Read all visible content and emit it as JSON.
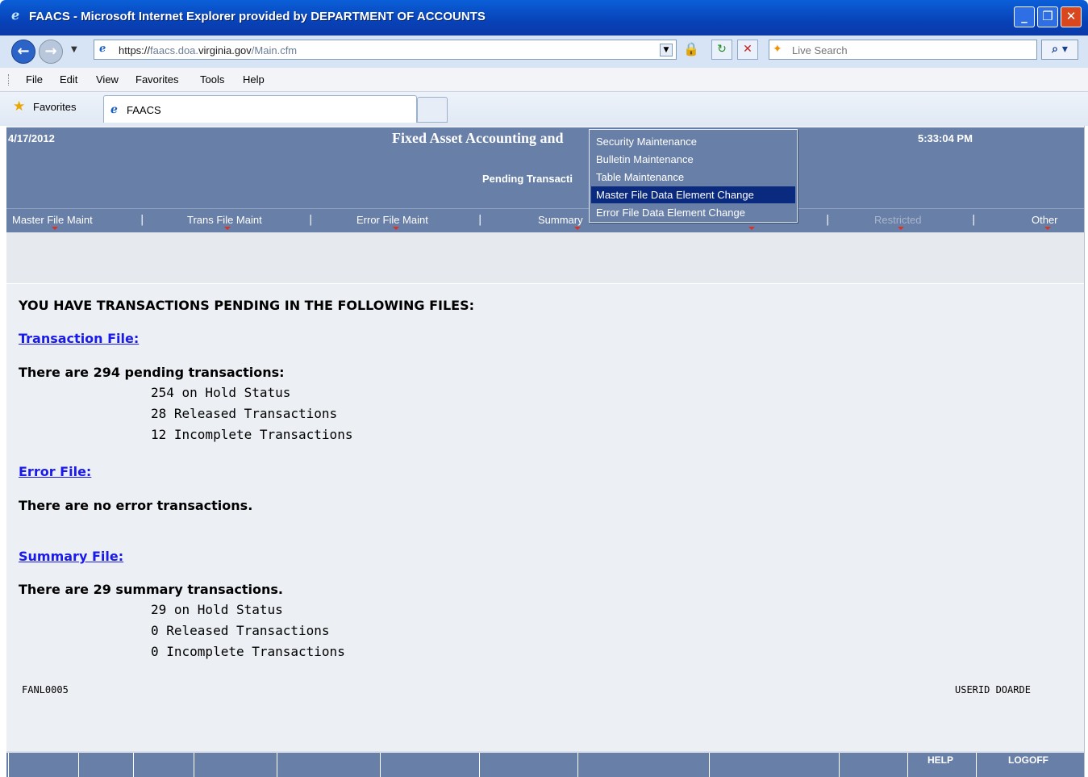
{
  "window": {
    "title": "FAACS - Microsoft Internet Explorer provided by DEPARTMENT OF ACCOUNTS",
    "minimize": "_",
    "maximize": "❐",
    "close": "✕"
  },
  "address_bar": {
    "url_prefix": "https://",
    "url_host_faint": "faacs.doa.",
    "url_host": "virginia.gov",
    "url_path": "/Main.cfm",
    "search_placeholder": "Live Search"
  },
  "menu": {
    "items": [
      "File",
      "Edit",
      "View",
      "Favorites",
      "Tools",
      "Help"
    ]
  },
  "favorites_bar": {
    "favorites_label": "Favorites",
    "tab_label": "FAACS"
  },
  "header": {
    "date": "4/17/2012",
    "app_title": "Fixed Asset Accounting and",
    "time": "5:33:04 PM",
    "subtitle": "Pending Transacti"
  },
  "nav": {
    "items": [
      {
        "label": "Master File Maint",
        "enabled": true
      },
      {
        "label": "Trans File Maint",
        "enabled": true
      },
      {
        "label": "Error File Maint",
        "enabled": true
      },
      {
        "label": "Summary",
        "enabled": true
      },
      {
        "label": "Restricted",
        "enabled": false
      },
      {
        "label": "Other",
        "enabled": true
      }
    ],
    "separator": "|"
  },
  "dropdown": {
    "items": [
      "Security Maintenance",
      "Bulletin Maintenance",
      "Table Maintenance",
      "Master File Data Element Change",
      "Error File Data Element Change"
    ],
    "active_item": "Master File Data Element Change"
  },
  "content": {
    "heading": "YOU HAVE TRANSACTIONS PENDING IN THE FOLLOWING FILES:",
    "transaction_file": {
      "link": "Transaction File:",
      "summary": "There are 294 pending transactions:",
      "lines": [
        "254 on Hold Status",
        "28 Released Transactions",
        "12 Incomplete Transactions"
      ]
    },
    "error_file": {
      "link": "Error File:",
      "summary": "There are no error transactions."
    },
    "summary_file": {
      "link": "Summary File:",
      "summary": "There are 29 summary transactions.",
      "lines": [
        "29 on Hold Status",
        "0 Released Transactions",
        "0 Incomplete Transactions"
      ]
    },
    "screen_id": "FANL0005",
    "userid": "USERID DOARDE"
  },
  "bottom_bar": {
    "help": "HELP",
    "logoff": "LOGOFF"
  },
  "colors": {
    "header_bg": "#687fa7",
    "link": "#1a1aeb",
    "dropdown_active": "#0a2a80"
  }
}
